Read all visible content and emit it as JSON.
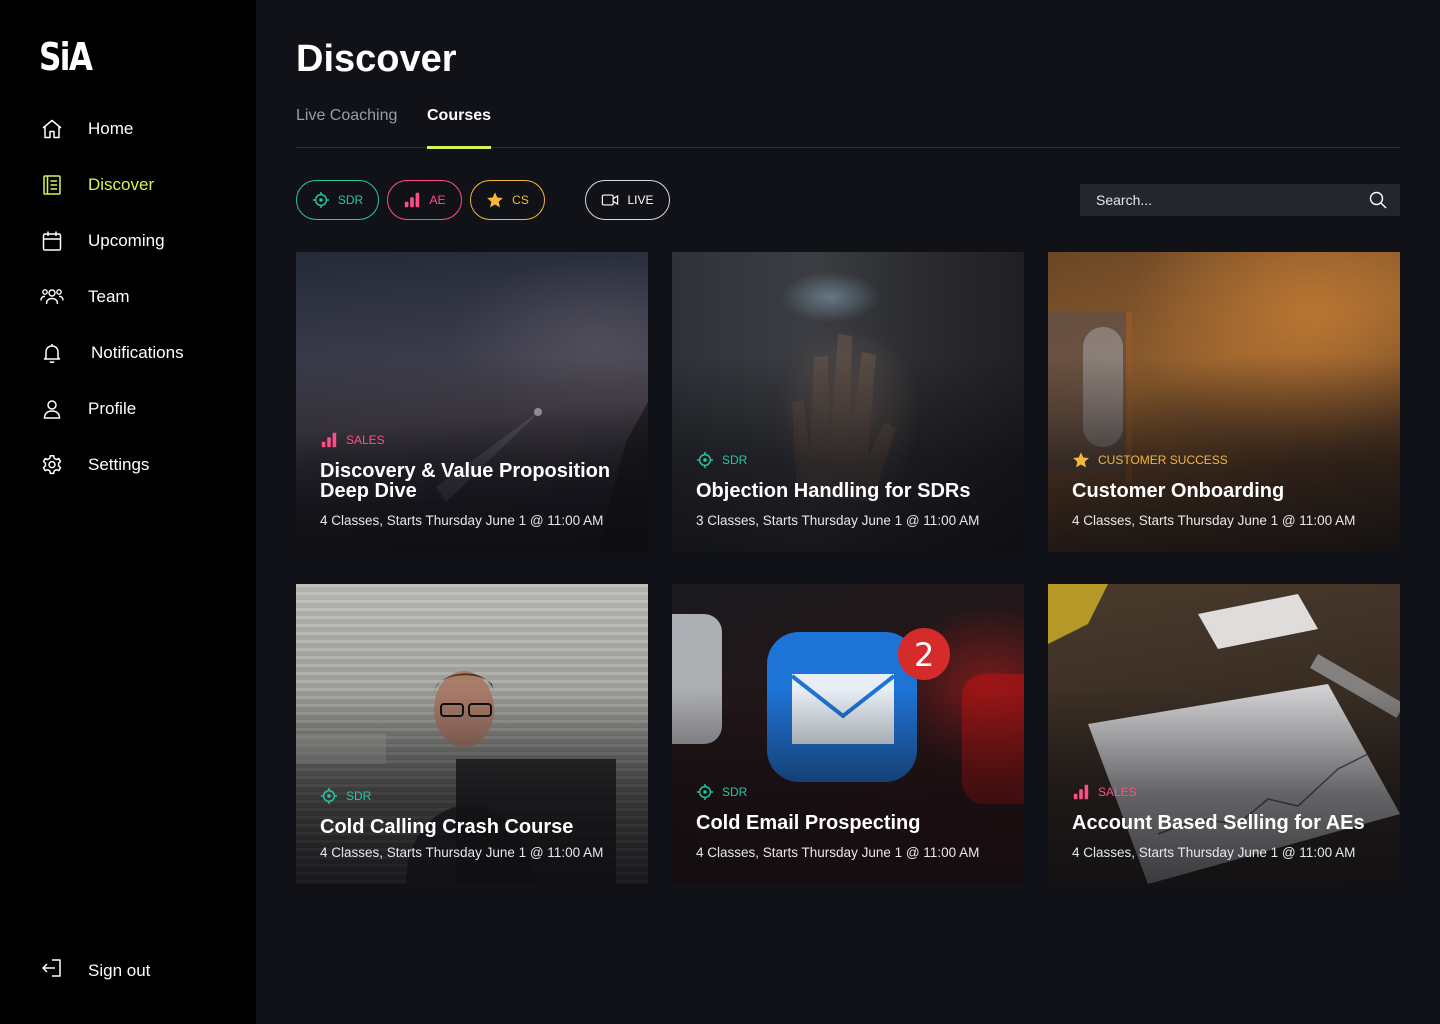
{
  "app": {
    "logo": "SiA"
  },
  "sidebar": {
    "items": [
      {
        "label": "Home",
        "icon": "home-icon"
      },
      {
        "label": "Discover",
        "icon": "book-icon",
        "active": true
      },
      {
        "label": "Upcoming",
        "icon": "calendar-icon"
      },
      {
        "label": "Team",
        "icon": "team-icon"
      },
      {
        "label": "Notifications",
        "icon": "bell-icon"
      },
      {
        "label": "Profile",
        "icon": "user-icon"
      },
      {
        "label": "Settings",
        "icon": "gear-icon"
      }
    ],
    "signout": {
      "label": "Sign out",
      "icon": "sign-out-icon"
    }
  },
  "page": {
    "title": "Discover",
    "tabs": [
      {
        "label": "Live Coaching"
      },
      {
        "label": "Courses",
        "active": true
      }
    ]
  },
  "filters": {
    "sdr": "SDR",
    "ae": "AE",
    "cs": "CS",
    "live": "LIVE"
  },
  "search": {
    "placeholder": "Search..."
  },
  "colors": {
    "accent": "#d6f25a",
    "sdr": "#23c9a0",
    "sales": "#ff4f86",
    "cs": "#f5b63c",
    "sidebar_bg": "#000000",
    "main_bg": "#111217"
  },
  "courses": [
    {
      "category": "SALES",
      "category_icon": "bar-chart-icon",
      "title": "Discovery & Value Proposition Deep Dive",
      "meta": "4 Classes, Starts Thursday June 1 @ 11:00 AM"
    },
    {
      "category": "SDR",
      "category_icon": "target-icon",
      "title": "Objection Handling for SDRs",
      "meta": "3 Classes, Starts Thursday June 1 @ 11:00 AM"
    },
    {
      "category": "CUSTOMER SUCCESS",
      "category_icon": "star-icon",
      "title": "Customer Onboarding",
      "meta": "4 Classes, Starts Thursday June 1 @ 11:00 AM"
    },
    {
      "category": "SDR",
      "category_icon": "target-icon",
      "title": "Cold Calling Crash Course",
      "meta": "4 Classes, Starts Thursday June 1 @ 11:00 AM"
    },
    {
      "category": "SDR",
      "category_icon": "target-icon",
      "title": "Cold Email Prospecting",
      "meta": "4 Classes, Starts Thursday June 1 @ 11:00 AM"
    },
    {
      "category": "SALES",
      "category_icon": "bar-chart-icon",
      "title": "Account Based Selling for AEs",
      "meta": "4 Classes, Starts Thursday June 1 @ 11:00 AM"
    }
  ]
}
